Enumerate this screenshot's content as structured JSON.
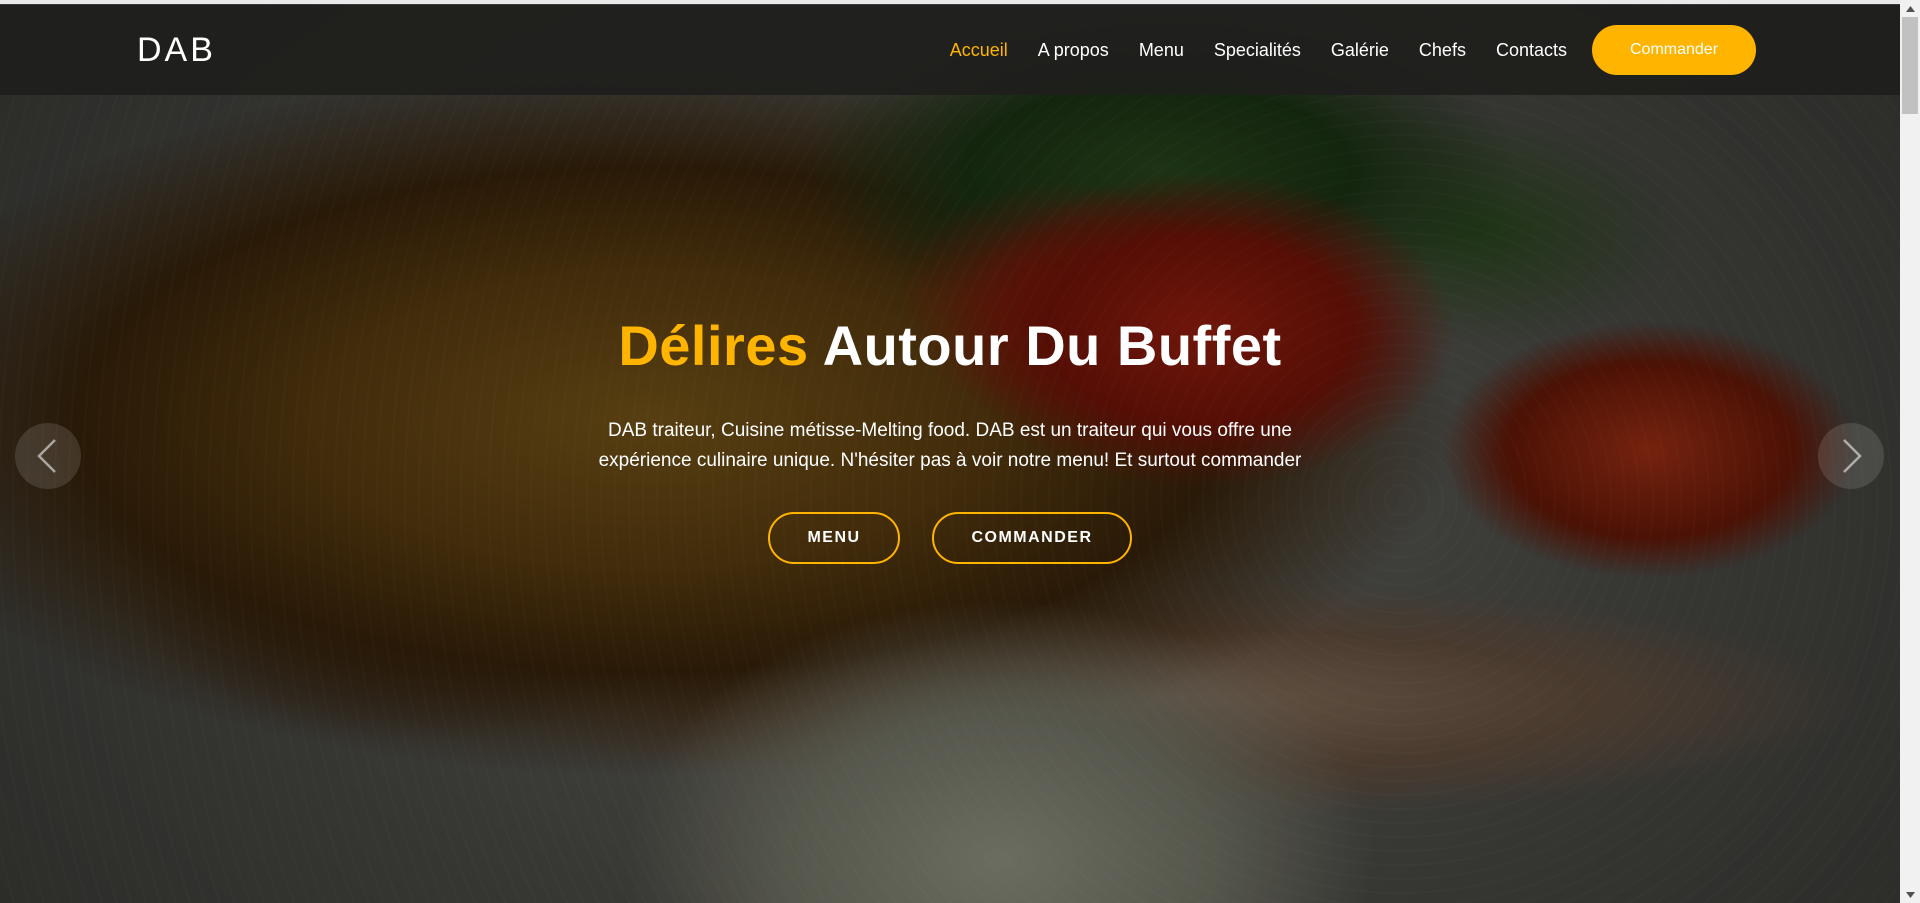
{
  "brand": {
    "logo": "DAB"
  },
  "nav": {
    "items": [
      {
        "label": "Accueil",
        "active": true
      },
      {
        "label": "A propos"
      },
      {
        "label": "Menu"
      },
      {
        "label": "Specialités"
      },
      {
        "label": "Galérie"
      },
      {
        "label": "Chefs"
      },
      {
        "label": "Contacts"
      }
    ],
    "cta_label": "Commander"
  },
  "hero": {
    "title_accent": "Délires",
    "title_rest": "Autour Du Buffet",
    "description": "DAB traiteur, Cuisine métisse-Melting food. DAB est un traiteur qui vous offre une expérience culinaire unique. N'hésiter pas à voir notre menu! Et surtout commander",
    "buttons": {
      "menu_label": "MENU",
      "order_label": "COMMANDER"
    }
  },
  "icons": {
    "prev": "chevron-left-icon",
    "next": "chevron-right-icon"
  },
  "colors": {
    "accent": "#ffb400",
    "navbar": "#1e1e1c",
    "text": "#ffffff"
  }
}
